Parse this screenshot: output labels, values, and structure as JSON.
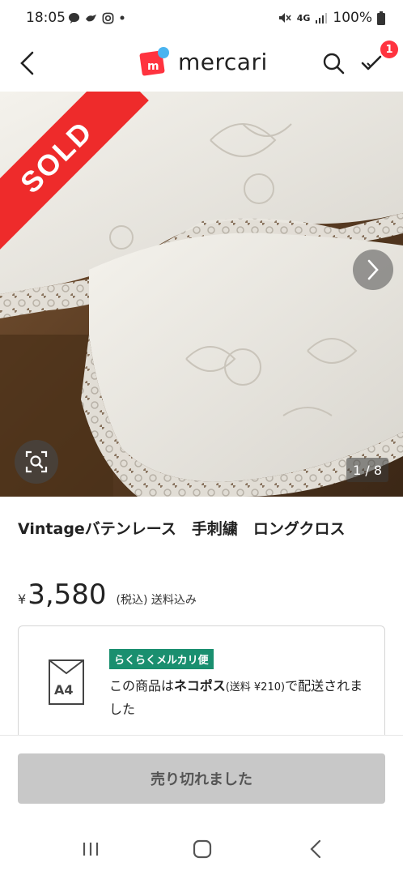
{
  "status_bar": {
    "time": "18:05",
    "network": "4G",
    "battery": "100%"
  },
  "header": {
    "logo_text": "mercari",
    "notification_count": "1"
  },
  "hero": {
    "sold_label": "SOLD",
    "image_counter": "1 / 8"
  },
  "product": {
    "title": "Vintageバテンレース　手刺繍　ロングクロス",
    "currency": "¥",
    "price": "3,580",
    "tax_note": "(税込) 送料込み"
  },
  "shipping": {
    "size_label": "A4",
    "method_tag": "らくらくメルカリ便",
    "desc_prefix": "この商品は",
    "desc_method": "ネコポス",
    "desc_fee": "(送料 ¥210)",
    "desc_suffix": "で配送されました"
  },
  "action": {
    "sold_out_label": "売り切れました"
  },
  "colors": {
    "brand_red": "#ff333f",
    "sold_ribbon": "#ee2b2b",
    "shipping_tag": "#1a8f6f",
    "disabled_button": "#c8c8c8"
  }
}
